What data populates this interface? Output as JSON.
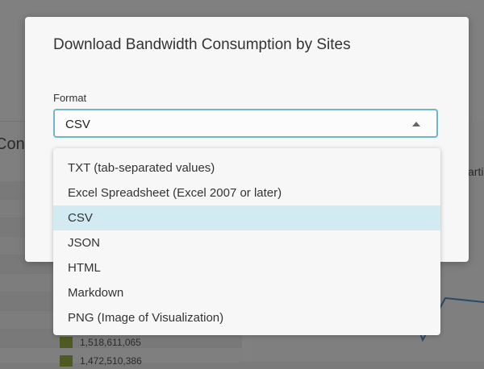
{
  "dialog": {
    "title": "Download Bandwidth Consumption by Sites",
    "format_label": "Format",
    "selected_value": "CSV"
  },
  "format_options": [
    {
      "label": "TXT (tab-separated values)",
      "selected": false
    },
    {
      "label": "Excel Spreadsheet (Excel 2007 or later)",
      "selected": false
    },
    {
      "label": "CSV",
      "selected": true
    },
    {
      "label": "JSON",
      "selected": false
    },
    {
      "label": "HTML",
      "selected": false
    },
    {
      "label": "Markdown",
      "selected": false
    },
    {
      "label": "PNG (Image of Visualization)",
      "selected": false
    }
  ],
  "background": {
    "left_title_fragment": "Cons",
    "right_title_fragment": "arti",
    "table_values": [
      "1,518,611,065",
      "1,472,510,386"
    ]
  },
  "colors": {
    "accent_border": "#6fb6c9",
    "selected_option_bg": "#d2ebf3",
    "bar_swatch": "#4d5a22"
  }
}
